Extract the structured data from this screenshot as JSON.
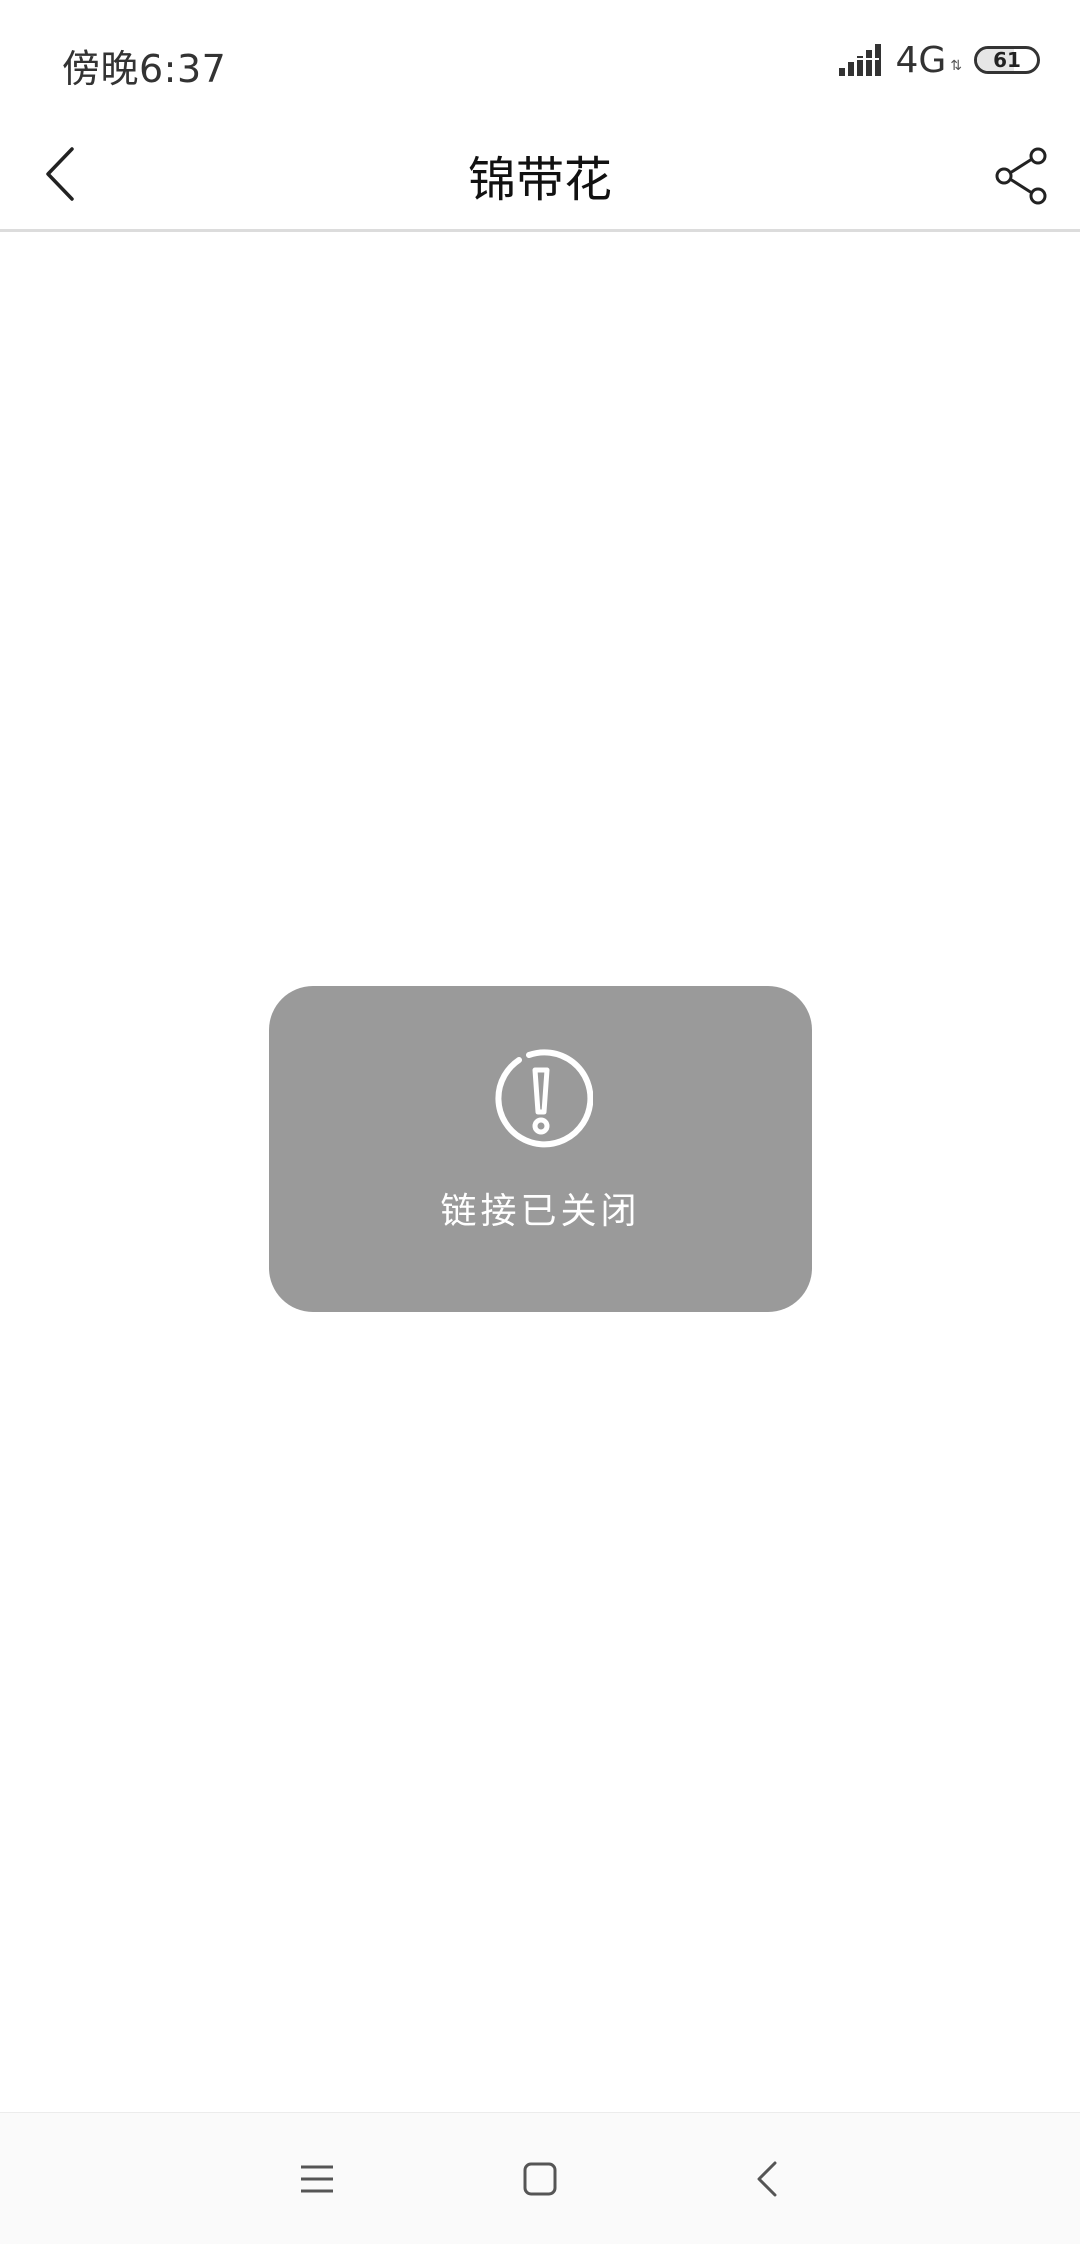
{
  "status_bar": {
    "time": "傍晚6:37",
    "network": "4G",
    "battery_level": "61"
  },
  "header": {
    "title": "锦带花",
    "back_icon": "chevron-left-icon",
    "share_icon": "share-icon"
  },
  "toast": {
    "icon": "alert-circle-icon",
    "message": "链接已关闭"
  },
  "nav_bar": {
    "menu_icon": "menu-icon",
    "home_icon": "home-square-icon",
    "back_icon": "back-chevron-icon"
  },
  "colors": {
    "toast_background": "#9a9a9a",
    "divider": "#dcdcdc",
    "text_primary": "#111111"
  }
}
